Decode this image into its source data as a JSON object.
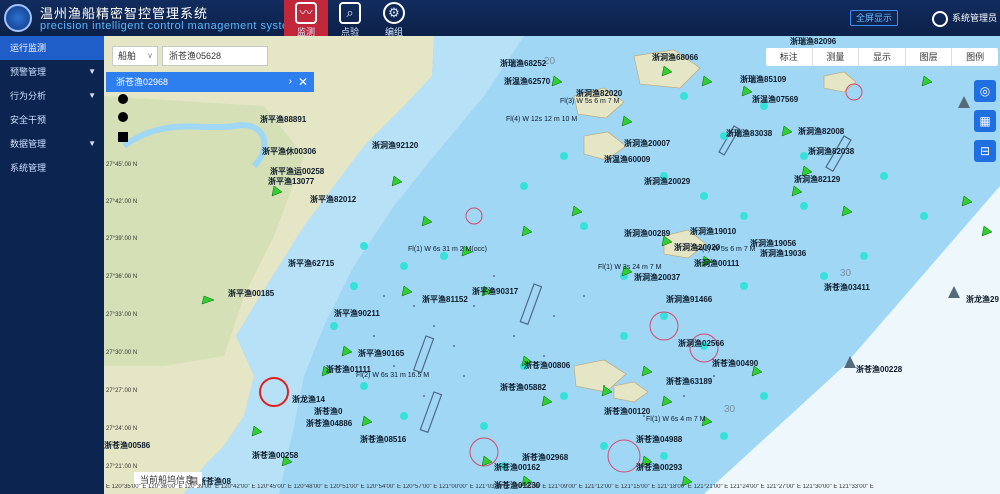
{
  "app": {
    "title_cn": "温州渔船精密智控管理系统",
    "title_en": "precision intelligent control management system"
  },
  "nav_tabs": [
    {
      "label": "监测",
      "icon": "monitor-chart-icon",
      "active": true
    },
    {
      "label": "点验",
      "icon": "document-search-icon",
      "active": false
    },
    {
      "label": "编组",
      "icon": "group-icon",
      "active": false
    }
  ],
  "header": {
    "fullscreen_label": "全屏显示",
    "user_name": "系统管理员"
  },
  "sidebar": {
    "items": [
      {
        "label": "运行监测",
        "has_arrow": false,
        "active": true
      },
      {
        "label": "预警管理",
        "has_arrow": true,
        "active": false
      },
      {
        "label": "行为分析",
        "has_arrow": true,
        "active": false
      },
      {
        "label": "安全干预",
        "has_arrow": false,
        "active": false
      },
      {
        "label": "数据管理",
        "has_arrow": true,
        "active": false
      },
      {
        "label": "系统管理",
        "has_arrow": false,
        "active": false
      }
    ]
  },
  "map_controls": {
    "type_select": "船舶",
    "search_value": "浙苍渔05628",
    "selected_ship_panel": "浙苍渔02968",
    "tools": [
      "标注",
      "测量",
      "显示",
      "图层",
      "图例"
    ],
    "vessel_info_label": "当前船坞信息"
  },
  "map": {
    "latitudes": [
      "27°45'.00 N",
      "27°42'.00 N",
      "27°39'.00 N",
      "27°36'.00 N",
      "27°33'.00 N",
      "27°30'.00 N",
      "27°27'.00 N",
      "27°24'.00 N",
      "27°21'.00 N"
    ],
    "longitude_bar": "E 120°35'00\" E 120°36'00\" E 120°39'00\" E 120°42'00\" E 120°45'00\" E 120°48'00\" E 120°51'00\" E 120°54'00\" E 120°57'00\" E 121°00'00\" E 121°03'00\" E 121°06'00\" E 121°09'00\" E 121°12'00\" E 121°15'00\" E 121°18'00\" E 121°21'00\" E 121°24'00\" E 121°27'00\" E 121°30'00\" E 121°33'00\" E",
    "vessels": [
      "浙平渔88891",
      "浙平渔休00306",
      "浙平渔运00258",
      "浙平渔13077",
      "浙平渔82012",
      "浙洞渔92120",
      "浙瑞渔68252",
      "浙温渔62570",
      "浙洞渔82020",
      "浙洞渔20007",
      "浙温渔60009",
      "浙瑞渔82096",
      "浙洞渔68066",
      "浙瑞渔85109",
      "浙温渔07569",
      "浙瑞渔83038",
      "浙洞渔82008",
      "浙洞渔82038",
      "浙洞渔82129",
      "浙洞渔20029",
      "浙洞渔00289",
      "浙洞渔19010",
      "浙洞渔19056",
      "浙洞渔19036",
      "浙洞渔20020",
      "浙洞渔20037",
      "浙洞渔00111",
      "浙洞渔91466",
      "浙苍渔03411",
      "浙龙渔29",
      "浙平渔62715",
      "浙平渔00185",
      "浙平渔81152",
      "浙平渔90317",
      "浙平渔90211",
      "浙平渔90165",
      "浙洞渔02566",
      "浙苍渔00806",
      "浙苍渔00490",
      "浙苍渔63189",
      "浙苍渔05882",
      "浙苍渔01111",
      "浙苍渔00120",
      "浙苍渔04988",
      "浙苍渔00228",
      "浙苍渔04886",
      "浙苍渔08516",
      "浙苍渔00258",
      "浙苍渔02968",
      "浙苍渔00162",
      "浙苍渔00293",
      "浙苍渔01230",
      "浙苍渔00586",
      "浙苍渔08",
      "浙龙渔14",
      "浙苍渔0"
    ],
    "soundings": [
      "30",
      "30",
      "20"
    ],
    "lighthouse_texts": [
      "Fl(4) W 12s 12 m 10 M",
      "Fl(3) W 5s 6 m 7 M",
      "Fl(1) W 6s 31 m 2 M(occ)",
      "Fl(1) W 3s 24 m 7 M",
      "Fl(2) W 6s 31 m 16.5 M",
      "Fl(1) W 5s 6 m 7 M",
      "Fl(1) W 6s 4 m 7 M"
    ]
  }
}
